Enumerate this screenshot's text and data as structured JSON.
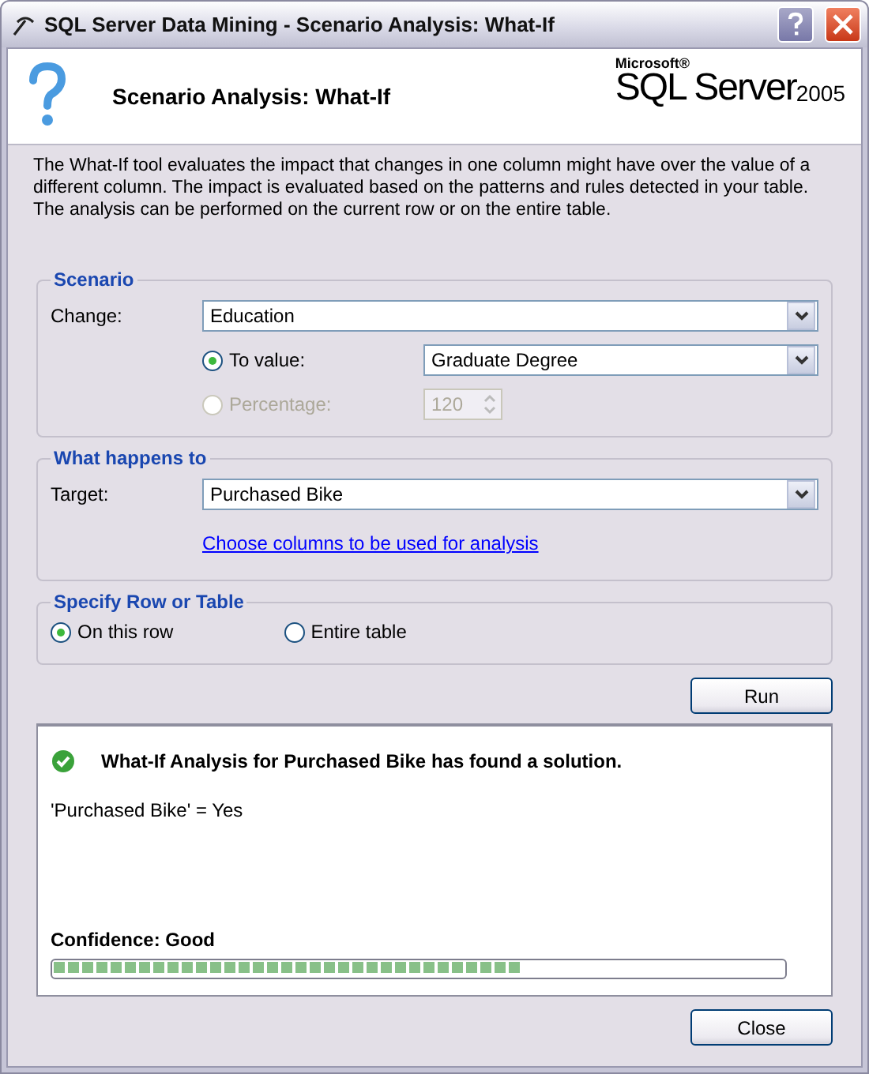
{
  "window": {
    "title": "SQL Server Data Mining - Scenario Analysis: What-If"
  },
  "header": {
    "title": "Scenario Analysis: What-If",
    "logo": {
      "maker": "Microsoft®",
      "product": "SQL Server",
      "version": "2005"
    }
  },
  "description": "The What-If tool evaluates the impact that changes in one column might have over the value of a different column. The impact is evaluated based on the patterns and rules detected in your table. The analysis can be performed on the current row or on the entire table.",
  "scenario": {
    "legend": "Scenario",
    "change_label": "Change:",
    "change_value": "Education",
    "options": [
      {
        "label": "To value:",
        "selected": true,
        "disabled": false,
        "kind": "dropdown",
        "value": "Graduate Degree"
      },
      {
        "label": "Percentage:",
        "selected": false,
        "disabled": true,
        "kind": "spinner",
        "value": "120"
      }
    ]
  },
  "target": {
    "legend": "What happens to",
    "label": "Target:",
    "value": "Purchased Bike",
    "link": "Choose columns to be used for analysis"
  },
  "scope": {
    "legend": "Specify Row or Table",
    "options": [
      {
        "label": "On this row",
        "selected": true
      },
      {
        "label": "Entire table",
        "selected": false
      }
    ]
  },
  "run_button": "Run",
  "result": {
    "found": true,
    "headline": "What-If Analysis for Purchased Bike has found a solution.",
    "detail": "'Purchased Bike' = Yes",
    "confidence": "Confidence: Good",
    "level": 0.64
  },
  "close_button": "Close"
}
